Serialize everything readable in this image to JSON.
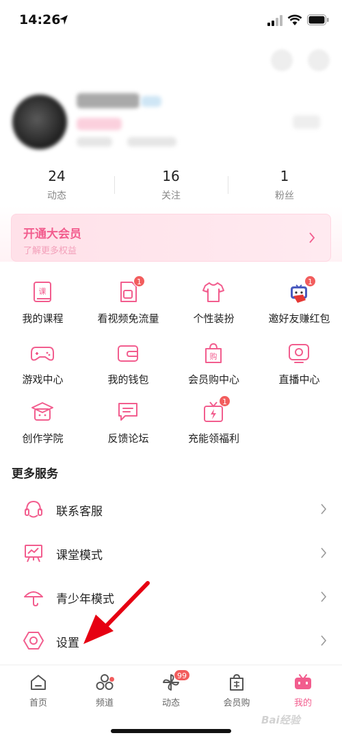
{
  "status_bar": {
    "time": "14:26"
  },
  "stats": [
    {
      "value": "24",
      "label": "动态"
    },
    {
      "value": "16",
      "label": "关注"
    },
    {
      "value": "1",
      "label": "粉丝"
    }
  ],
  "vip": {
    "title": "开通大会员",
    "subtitle": "了解更多权益"
  },
  "services": [
    {
      "label": "我的课程",
      "icon": "course-book-icon",
      "badge": ""
    },
    {
      "label": "看视频免流量",
      "icon": "sim-card-icon",
      "badge": "1"
    },
    {
      "label": "个性装扮",
      "icon": "tshirt-icon",
      "badge": ""
    },
    {
      "label": "邀好友赚红包",
      "icon": "invite-gift-icon",
      "badge": "1"
    },
    {
      "label": "游戏中心",
      "icon": "gamepad-icon",
      "badge": ""
    },
    {
      "label": "我的钱包",
      "icon": "wallet-icon",
      "badge": ""
    },
    {
      "label": "会员购中心",
      "icon": "shopping-bag-icon",
      "badge": ""
    },
    {
      "label": "直播中心",
      "icon": "live-tv-icon",
      "badge": ""
    },
    {
      "label": "创作学院",
      "icon": "graduation-cap-icon",
      "badge": ""
    },
    {
      "label": "反馈论坛",
      "icon": "chat-bubble-icon",
      "badge": ""
    },
    {
      "label": "充能领福利",
      "icon": "energy-gift-icon",
      "badge": "1"
    }
  ],
  "more_services": {
    "title": "更多服务",
    "items": [
      {
        "label": "联系客服",
        "icon": "headset-icon"
      },
      {
        "label": "课堂模式",
        "icon": "classroom-board-icon"
      },
      {
        "label": "青少年模式",
        "icon": "umbrella-icon"
      },
      {
        "label": "设置",
        "icon": "settings-hexagon-icon"
      }
    ]
  },
  "tabbar": [
    {
      "label": "首页",
      "icon": "home-icon",
      "active": false
    },
    {
      "label": "频道",
      "icon": "channels-icon",
      "active": false
    },
    {
      "label": "动态",
      "icon": "pinwheel-icon",
      "active": false,
      "badge": "99"
    },
    {
      "label": "会员购",
      "icon": "shop-bag-icon",
      "active": false
    },
    {
      "label": "我的",
      "icon": "tv-face-icon",
      "active": true
    }
  ],
  "watermark": "Bai经验",
  "colors": {
    "accent": "#f25d8e",
    "badge": "#f25d5d",
    "text": "#222222",
    "muted": "#888888"
  }
}
